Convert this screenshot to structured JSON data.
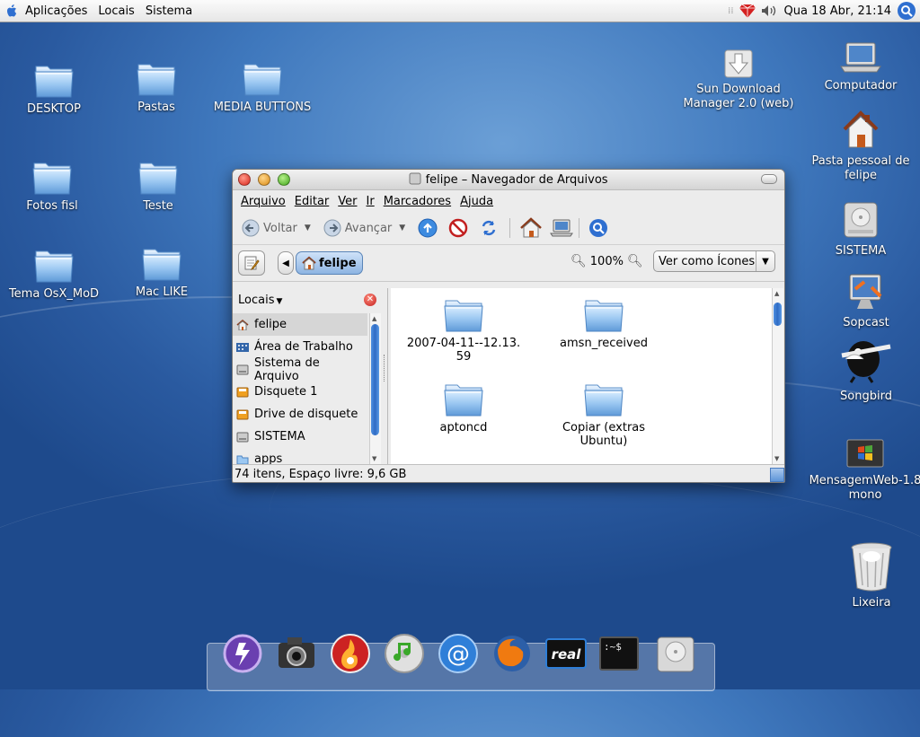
{
  "top_panel": {
    "menus": [
      "Aplicações",
      "Locais",
      "Sistema"
    ],
    "clock": "Qua 18 Abr, 21:14"
  },
  "desktop_icons_left": [
    {
      "label": "DESKTOP"
    },
    {
      "label": "Pastas"
    },
    {
      "label": "MEDIA BUTTONS"
    },
    {
      "label": "Fotos fisl"
    },
    {
      "label": "Teste"
    },
    {
      "label": "Tema OsX_MoD"
    },
    {
      "label": "Mac LIKE"
    }
  ],
  "desktop_icons_right": [
    {
      "label": "Sun Download Manager 2.0 (web)",
      "icon": "download-icon"
    },
    {
      "label": "Computador",
      "icon": "laptop-icon"
    },
    {
      "label": "Pasta pessoal de felipe",
      "icon": "home-icon"
    },
    {
      "label": "SISTEMA",
      "icon": "hard-drive-icon"
    },
    {
      "label": "Sopcast",
      "icon": "sopcast-icon"
    },
    {
      "label": "Songbird",
      "icon": "songbird-icon"
    },
    {
      "label": "MensagemWeb-1.8 mono",
      "icon": "windows-icon"
    },
    {
      "label": "Lixeira",
      "icon": "trash-icon"
    }
  ],
  "window": {
    "title": "felipe – Navegador de Arquivos",
    "menus": [
      "Arquivo",
      "Editar",
      "Ver",
      "Ir",
      "Marcadores",
      "Ajuda"
    ],
    "toolbar": {
      "back": "Voltar",
      "forward": "Avançar"
    },
    "location": {
      "crumb": "felipe",
      "zoom": "100%",
      "view_mode": "Ver como Ícones"
    },
    "sidebar": {
      "header": "Locais",
      "items": [
        {
          "label": "felipe",
          "icon": "home-icon"
        },
        {
          "label": "Área de Trabalho",
          "icon": "desktop-icon"
        },
        {
          "label": "Sistema de Arquivo",
          "icon": "drive-icon"
        },
        {
          "label": "Disquete 1",
          "icon": "floppy-icon"
        },
        {
          "label": "Drive de disquete",
          "icon": "floppy-icon"
        },
        {
          "label": "SISTEMA",
          "icon": "drive-icon"
        },
        {
          "label": "apps",
          "icon": "folder-icon"
        }
      ]
    },
    "files": [
      {
        "label": "2007-04-11--12.13.59"
      },
      {
        "label": "amsn_received"
      },
      {
        "label": "aptoncd"
      },
      {
        "label": "Copiar (extras Ubuntu)"
      }
    ],
    "status": "74 itens, Espaço livre: 9,6 GB"
  },
  "dock": {
    "items": [
      "media-player-icon",
      "camera-icon",
      "burner-icon",
      "itunes-icon",
      "mail-icon",
      "firefox-icon",
      "realplayer-icon",
      "terminal-icon",
      "hard-drive-icon"
    ]
  },
  "colors": {
    "desktop_blue": "#3f78bd",
    "panel_bg": "#eeeeee",
    "folder_blue": "#8ebcf0",
    "selection": "#d6d6d6"
  }
}
